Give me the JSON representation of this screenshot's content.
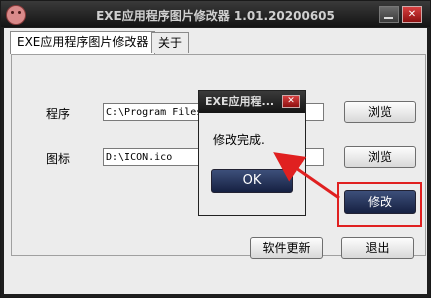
{
  "window": {
    "title": "EXE应用程序图片修改器 1.01.20200605"
  },
  "tabs": [
    {
      "label": "EXE应用程序图片修改器",
      "active": true
    },
    {
      "label": "关于",
      "active": false
    }
  ],
  "form": {
    "program_label": "程序",
    "program_value": "C:\\Program Files\\...\\TH...",
    "icon_label": "图标",
    "icon_value": "D:\\ICON.ico",
    "browse_label": "浏览",
    "modify_label": "修改",
    "update_label": "软件更新",
    "exit_label": "退出"
  },
  "dialog": {
    "title": "EXE应用程...",
    "message": "修改完成.",
    "ok_label": "OK"
  },
  "annotation": {
    "color": "#e02020"
  }
}
